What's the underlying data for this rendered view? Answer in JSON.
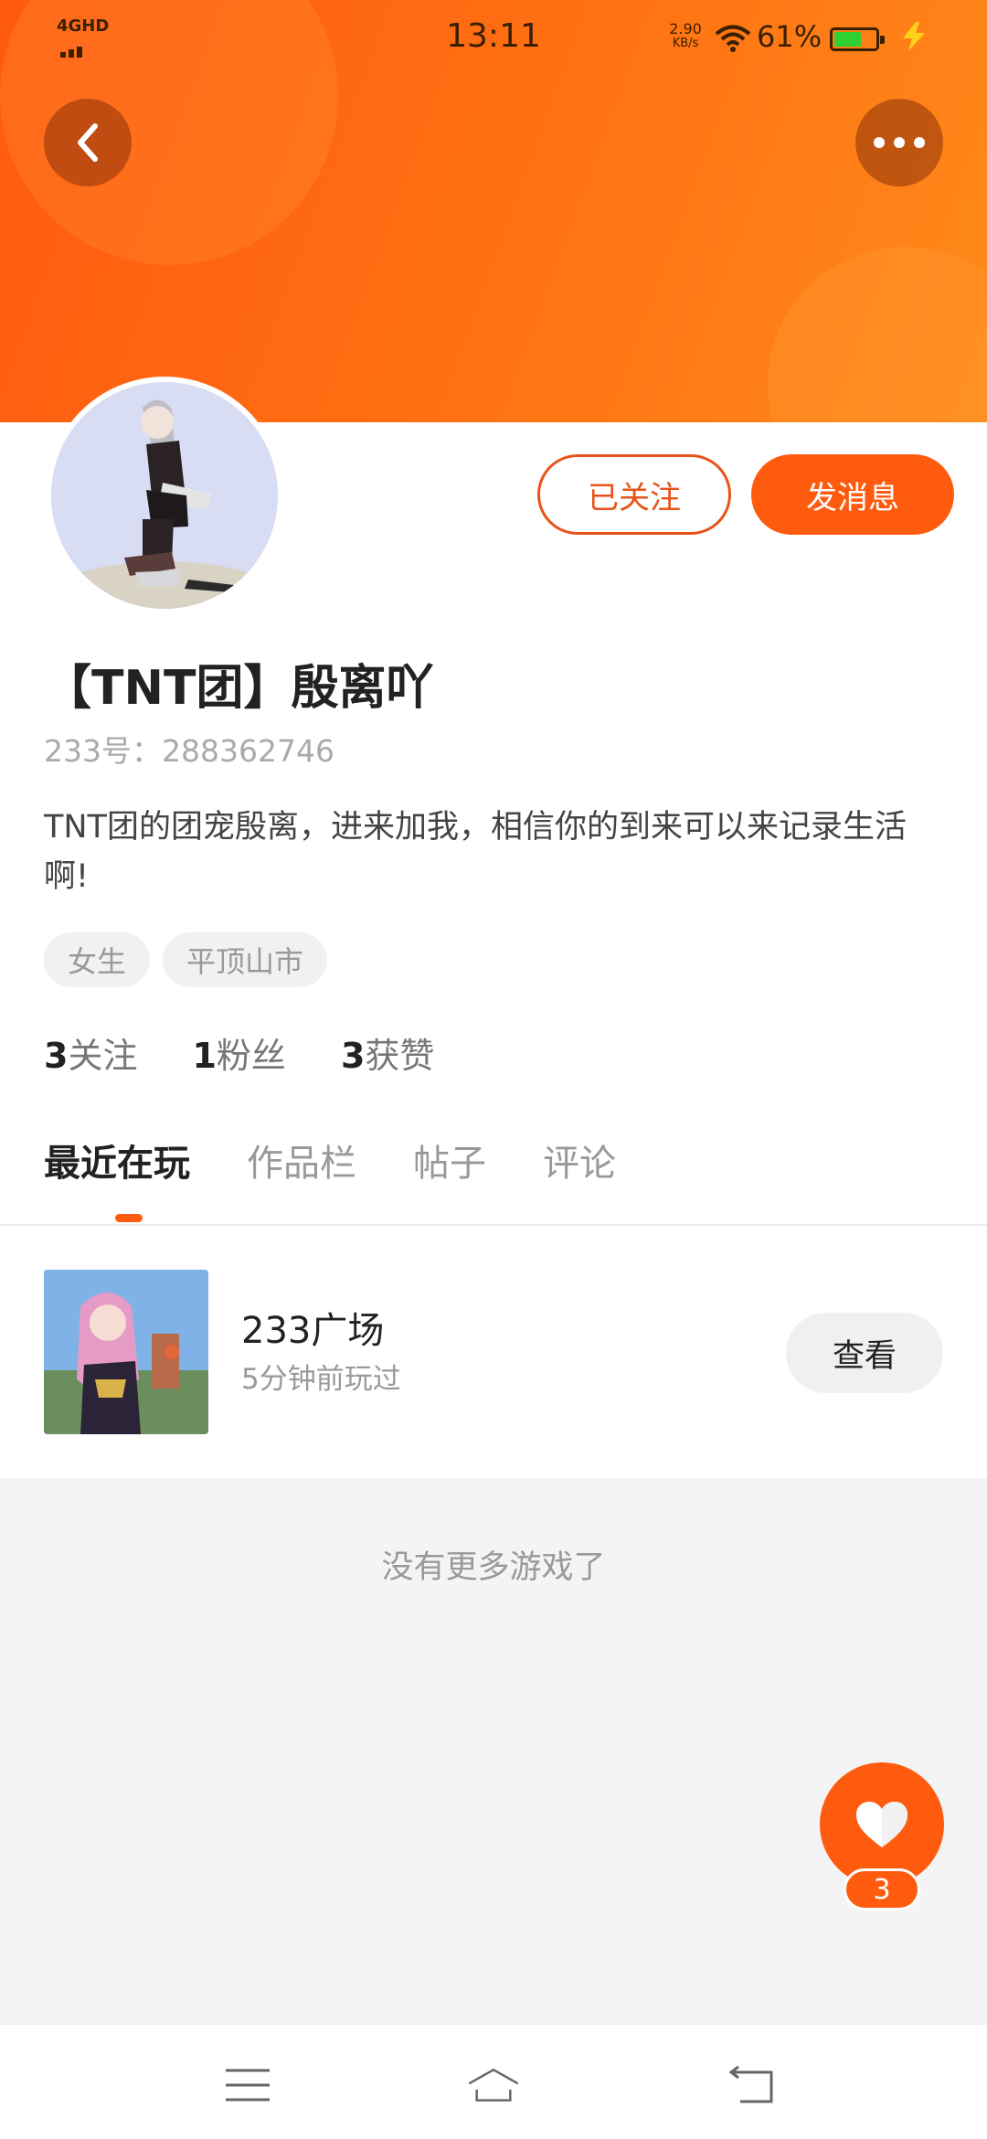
{
  "status_bar": {
    "network": "4GHD",
    "time": "13:11",
    "speed_value": "2.90",
    "speed_unit": "KB/s",
    "battery_percent": "61%",
    "battery_level": 0.61
  },
  "header": {
    "back_icon": "chevron-left-icon",
    "more_icon": "more-dots-icon"
  },
  "profile": {
    "name": "【TNT团】殷离吖",
    "id_text": "233号：288362746",
    "bio": "TNT团的团宠殷离，进来加我，相信你的到来可以来记录生活啊!",
    "tags": [
      "女生",
      "平顶山市"
    ],
    "follow_button": "已关注",
    "message_button": "发消息",
    "stats": [
      {
        "num": "3",
        "label": "关注"
      },
      {
        "num": "1",
        "label": "粉丝"
      },
      {
        "num": "3",
        "label": "获赞"
      }
    ]
  },
  "tabs": [
    "最近在玩",
    "作品栏",
    "帖子",
    "评论"
  ],
  "recent_games": [
    {
      "name": "233广场",
      "time": "5分钟前玩过",
      "action": "查看"
    }
  ],
  "empty_text": "没有更多游戏了",
  "like": {
    "count": "3",
    "icon": "heart-icon"
  },
  "nav": {
    "menu_icon": "menu-icon",
    "home_icon": "home-icon",
    "back_icon": "back-icon"
  },
  "colors": {
    "accent": "#ff5b0f",
    "banner_start": "#ff5a10",
    "banner_end": "#ff8a1a"
  }
}
